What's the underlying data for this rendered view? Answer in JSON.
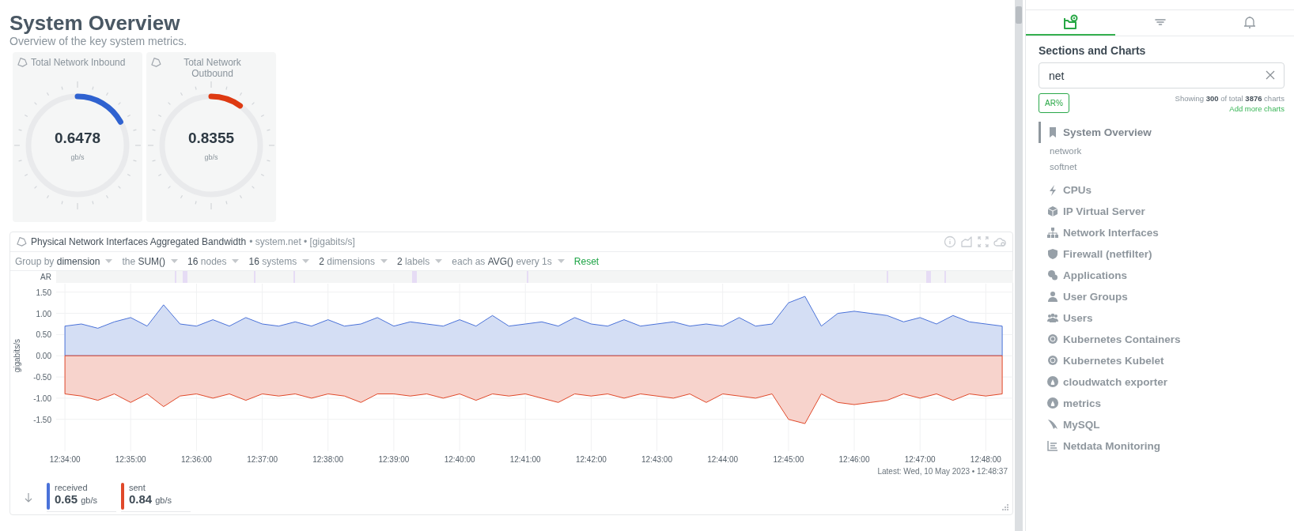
{
  "page": {
    "title": "System Overview",
    "subtitle": "Overview of the key system metrics."
  },
  "gauges": [
    {
      "title": "Total Network Inbound",
      "value": "0.6478",
      "unit": "gb/s",
      "level": 0.17,
      "color": "#2f62d0"
    },
    {
      "title": "Total Network Outbound",
      "value": "0.8355",
      "unit": "gb/s",
      "level": 0.1,
      "color": "#de3a12"
    }
  ],
  "chart_card": {
    "title": "Physical Network Interfaces Aggregated Bandwidth",
    "context": "• system.net • [gigabits/s]",
    "toolbar": [
      {
        "prefix": "Group by",
        "value": "dimension"
      },
      {
        "prefix": "the",
        "value": "SUM()"
      },
      {
        "value": "16",
        "suffix": "nodes"
      },
      {
        "value": "16",
        "suffix": "systems"
      },
      {
        "value": "2",
        "suffix": "dimensions"
      },
      {
        "value": "2",
        "suffix": "labels"
      },
      {
        "prefix": "each as",
        "value": "AVG()",
        "suffix": "every 1s"
      }
    ],
    "reset": "Reset",
    "annotation_label": "AR",
    "chart_data": {
      "type": "area",
      "ylabel": "gigabits/s",
      "ylim": [
        -2.25,
        1.7
      ],
      "grid": true,
      "yticks": [
        {
          "value": 1.5,
          "label": "1.50"
        },
        {
          "value": 1,
          "label": "1.00"
        },
        {
          "value": 0.5,
          "label": "0.50"
        },
        {
          "value": 0,
          "label": "0.00"
        },
        {
          "value": -0.5,
          "label": "-0.50"
        },
        {
          "value": -1,
          "label": "-1.00"
        },
        {
          "value": -1.5,
          "label": "-1.50"
        }
      ],
      "categories": [
        "12:34:00",
        null,
        null,
        null,
        "12:35:00",
        null,
        null,
        null,
        "12:36:00",
        null,
        null,
        null,
        "12:37:00",
        null,
        null,
        null,
        "12:38:00",
        null,
        null,
        null,
        "12:39:00",
        null,
        null,
        null,
        "12:40:00",
        null,
        null,
        null,
        "12:41:00",
        null,
        null,
        null,
        "12:42:00",
        null,
        null,
        null,
        "12:43:00",
        null,
        null,
        null,
        "12:44:00",
        null,
        null,
        null,
        "12:45:00",
        null,
        null,
        null,
        "12:46:00",
        null,
        null,
        null,
        "12:47:00",
        null,
        null,
        null,
        "12:48:00",
        null
      ],
      "series": [
        {
          "name": "received",
          "color": "#4a72d9",
          "values": [
            0.7,
            0.75,
            0.65,
            0.8,
            0.9,
            0.7,
            1.2,
            0.75,
            0.7,
            0.85,
            0.7,
            0.9,
            0.75,
            0.7,
            0.8,
            0.7,
            0.85,
            0.7,
            0.75,
            0.9,
            0.7,
            0.8,
            0.75,
            0.7,
            0.85,
            0.7,
            0.95,
            0.7,
            0.75,
            0.8,
            0.7,
            0.9,
            0.75,
            0.7,
            0.85,
            0.7,
            0.75,
            0.8,
            0.7,
            0.75,
            0.7,
            0.9,
            0.7,
            0.75,
            1.25,
            1.4,
            0.7,
            1.0,
            1.05,
            1.0,
            0.95,
            0.8,
            0.9,
            0.75,
            0.95,
            0.8,
            0.75,
            0.7
          ]
        },
        {
          "name": "sent",
          "color": "#e0492a",
          "values": [
            -0.9,
            -0.95,
            -1.05,
            -0.9,
            -1.1,
            -0.9,
            -1.2,
            -0.95,
            -0.9,
            -1.0,
            -0.9,
            -1.05,
            -0.9,
            -0.95,
            -0.9,
            -1.0,
            -0.9,
            -0.95,
            -1.1,
            -0.9,
            -0.9,
            -0.95,
            -0.9,
            -1.0,
            -0.9,
            -1.05,
            -0.9,
            -0.95,
            -0.9,
            -1.0,
            -1.1,
            -0.9,
            -0.95,
            -0.9,
            -1.0,
            -0.9,
            -0.95,
            -1.0,
            -0.9,
            -1.1,
            -0.9,
            -0.95,
            -1.0,
            -0.9,
            -1.5,
            -1.6,
            -0.9,
            -1.1,
            -1.15,
            -1.1,
            -1.05,
            -0.9,
            -1.0,
            -0.9,
            -1.05,
            -0.9,
            -0.95,
            -0.9
          ]
        }
      ]
    },
    "latest": "Latest: Wed, 10 May 2023 • 12:48:37",
    "legend": [
      {
        "value": "0.65",
        "unit": "gb/s"
      },
      {
        "value": "0.84",
        "unit": "gb/s"
      }
    ]
  },
  "sidebar": {
    "tabs": [
      {
        "selected": true
      },
      {
        "selected": false
      },
      {
        "selected": false
      }
    ],
    "heading": "Sections and Charts",
    "search": {
      "value": "net"
    },
    "chip": "AR%",
    "showing": "Showing **300** of total **3876** charts",
    "add_link": "Add more charts",
    "sections": [
      {
        "label": "System Overview",
        "selected": true,
        "children": [
          {
            "label": "network",
            "selected": false
          },
          {
            "label": "softnet",
            "selected": false
          }
        ]
      },
      {
        "label": "CPUs",
        "selected": false
      },
      {
        "label": "IP Virtual Server",
        "selected": false
      },
      {
        "label": "Network Interfaces",
        "selected": false
      },
      {
        "label": "Firewall (netfilter)",
        "selected": false
      },
      {
        "label": "Applications",
        "selected": false
      },
      {
        "label": "User Groups",
        "selected": false
      },
      {
        "label": "Users",
        "selected": false
      },
      {
        "label": "Kubernetes Containers",
        "selected": false
      },
      {
        "label": "Kubernetes Kubelet",
        "selected": false
      },
      {
        "label": "cloudwatch exporter",
        "selected": false
      },
      {
        "label": "metrics",
        "selected": false
      },
      {
        "label": "MySQL",
        "selected": false
      },
      {
        "label": "Netdata Monitoring",
        "selected": false
      }
    ]
  }
}
